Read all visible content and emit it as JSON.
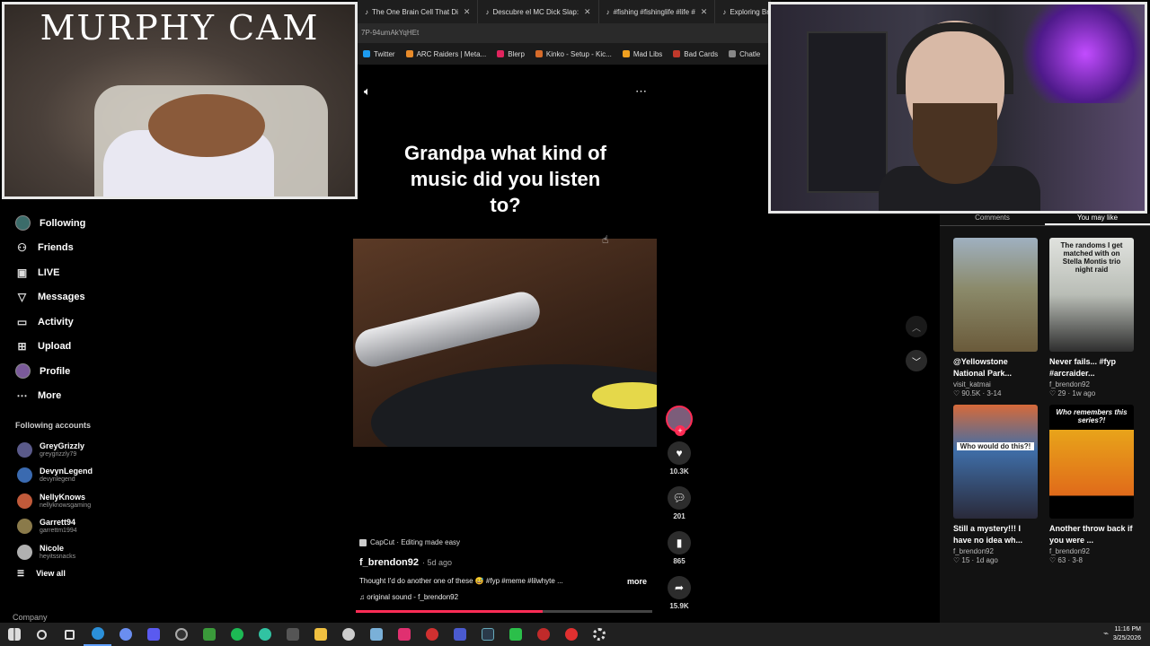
{
  "browser": {
    "tabs": [
      {
        "label": "The One Brain Cell That Di"
      },
      {
        "label": "Descubre el MC Dick Slap:"
      },
      {
        "label": "#fishing #fishinglife #life #"
      },
      {
        "label": "Exploring British an"
      }
    ],
    "url": "7P-94umAkYqHEt",
    "bookmarks": [
      {
        "label": "Twitter",
        "color": "#1d9bf0"
      },
      {
        "label": "ARC Raiders | Meta...",
        "color": "#e88b2a"
      },
      {
        "label": "Blerp",
        "color": "#e0245e"
      },
      {
        "label": "Kinko - Setup - Kic...",
        "color": "#d66b2a"
      },
      {
        "label": "Mad Libs",
        "color": "#f0a020"
      },
      {
        "label": "Bad Cards",
        "color": "#c0392b"
      },
      {
        "label": "Chatle",
        "color": "#888888"
      }
    ]
  },
  "webcam_left": {
    "title": "MURPHY CAM"
  },
  "nav": {
    "items": [
      {
        "label": "Following",
        "icon": "following-avatar"
      },
      {
        "label": "Friends",
        "icon": "friends-icon",
        "glyph": "👥"
      },
      {
        "label": "LIVE",
        "icon": "live-icon",
        "glyph": "▣"
      },
      {
        "label": "Messages",
        "icon": "messages-icon",
        "glyph": "▽"
      },
      {
        "label": "Activity",
        "icon": "activity-icon",
        "glyph": "▭"
      },
      {
        "label": "Upload",
        "icon": "upload-icon",
        "glyph": "⊞"
      },
      {
        "label": "Profile",
        "icon": "profile-avatar"
      },
      {
        "label": "More",
        "icon": "more-icon",
        "glyph": "⋯"
      }
    ],
    "following_title": "Following accounts",
    "accounts": [
      {
        "name": "GreyGrizzly",
        "handle": "greygrizzly79",
        "color": "#5a5a8a"
      },
      {
        "name": "DevynLegend",
        "handle": "devynlegend",
        "color": "#3a6ab0"
      },
      {
        "name": "NellyKnows",
        "handle": "nellyknowsgaming",
        "color": "#c05a3a"
      },
      {
        "name": "Garrett94",
        "handle": "garrettm1994",
        "color": "#8a7a4a"
      },
      {
        "name": "Nicole",
        "handle": "heyitssnacks",
        "color": "#b0b0b0"
      }
    ],
    "view_all": "View all",
    "company": "Company"
  },
  "video": {
    "caption": "Grandpa what kind of music did you listen to?",
    "capcut": "CapCut · Editing made easy",
    "author": "f_brendon92",
    "age": "· 5d ago",
    "description": "Thought I'd do another one of these 😅 #fyp #meme #lilwhyte ...",
    "more": "more",
    "sound": "♫  original sound - f_brendon92",
    "progress": 0.63,
    "likes": "10.3K",
    "comments": "201",
    "saves": "865",
    "shares": "15.9K"
  },
  "right_panel": {
    "tabs": [
      "Comments",
      "You may like"
    ],
    "cards": [
      {
        "title": "@Yellowstone National Park...",
        "user": "visit_katmai",
        "meta": "♡ 90.5K · 3-14",
        "thumb_text": "",
        "bg": "#8b8a6a"
      },
      {
        "title": "Never fails... #fyp #arcraider...",
        "user": "f_brendon92",
        "meta": "♡ 29 · 1w ago",
        "thumb_text": "The randoms I get matched with on Stella Montis trio night raid",
        "bg": "#c9ccc6"
      },
      {
        "title": "Still a mystery!!! I have no idea wh...",
        "user": "f_brendon92",
        "meta": "♡ 15 · 1d ago",
        "thumb_text": "Who would do this?!",
        "bg": "#3f6ea8"
      },
      {
        "title": "Another throw back if you were ...",
        "user": "f_brendon92",
        "meta": "♡ 63 · 3-8",
        "thumb_text": "Who remembers this series?!",
        "bg": "#e8a41a"
      }
    ]
  },
  "taskbar": {
    "time": "11:16 PM",
    "date": "3/25/2026"
  }
}
